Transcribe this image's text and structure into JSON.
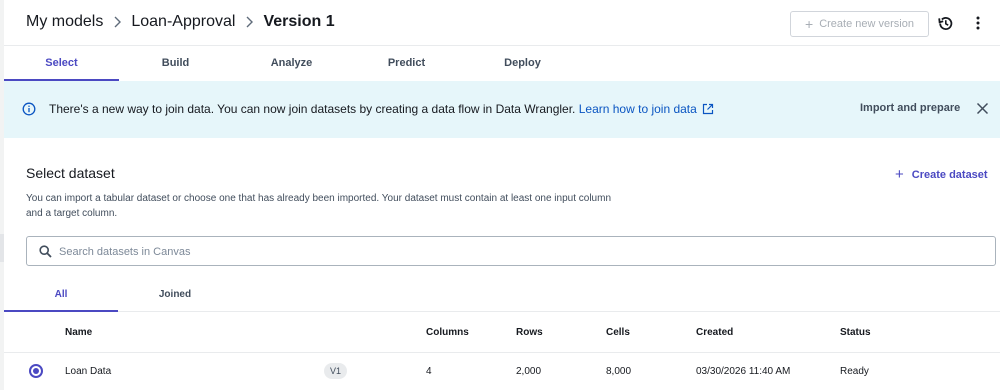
{
  "breadcrumb": {
    "items": [
      "My models",
      "Loan-Approval",
      "Version 1"
    ]
  },
  "header": {
    "create_version_label": "Create new version",
    "icons": {
      "history": "history-icon",
      "more": "more-vertical-icon"
    }
  },
  "tabs": [
    {
      "label": "Select",
      "active": true
    },
    {
      "label": "Build",
      "active": false
    },
    {
      "label": "Analyze",
      "active": false
    },
    {
      "label": "Predict",
      "active": false
    },
    {
      "label": "Deploy",
      "active": false
    }
  ],
  "banner": {
    "message": "There's a new way to join data. You can now join datasets by creating a data flow in Data Wrangler.",
    "link_label": "Learn how to join data",
    "action_label": "Import and prepare",
    "icons": {
      "info": "info-icon",
      "external": "external-link-icon",
      "close": "close-icon"
    }
  },
  "section": {
    "title": "Select dataset",
    "create_label": "Create dataset",
    "description": "You can import a tabular dataset or choose one that has already been imported. Your dataset must contain at least one input column and a target column."
  },
  "search": {
    "placeholder": "Search datasets in Canvas",
    "value": ""
  },
  "subtabs": [
    {
      "label": "All",
      "active": true
    },
    {
      "label": "Joined",
      "active": false
    }
  ],
  "table": {
    "columns": [
      "Name",
      "Columns",
      "Rows",
      "Cells",
      "Created",
      "Status"
    ],
    "rows": [
      {
        "selected": true,
        "name": "Loan Data",
        "version": "V1",
        "columns": "4",
        "rows": "2,000",
        "cells": "8,000",
        "created": "03/30/2026 11:40 AM",
        "status": "Ready"
      }
    ]
  },
  "colors": {
    "accent": "#4b49c2",
    "banner_bg": "#e6f6fa",
    "link": "#0a55c2"
  }
}
